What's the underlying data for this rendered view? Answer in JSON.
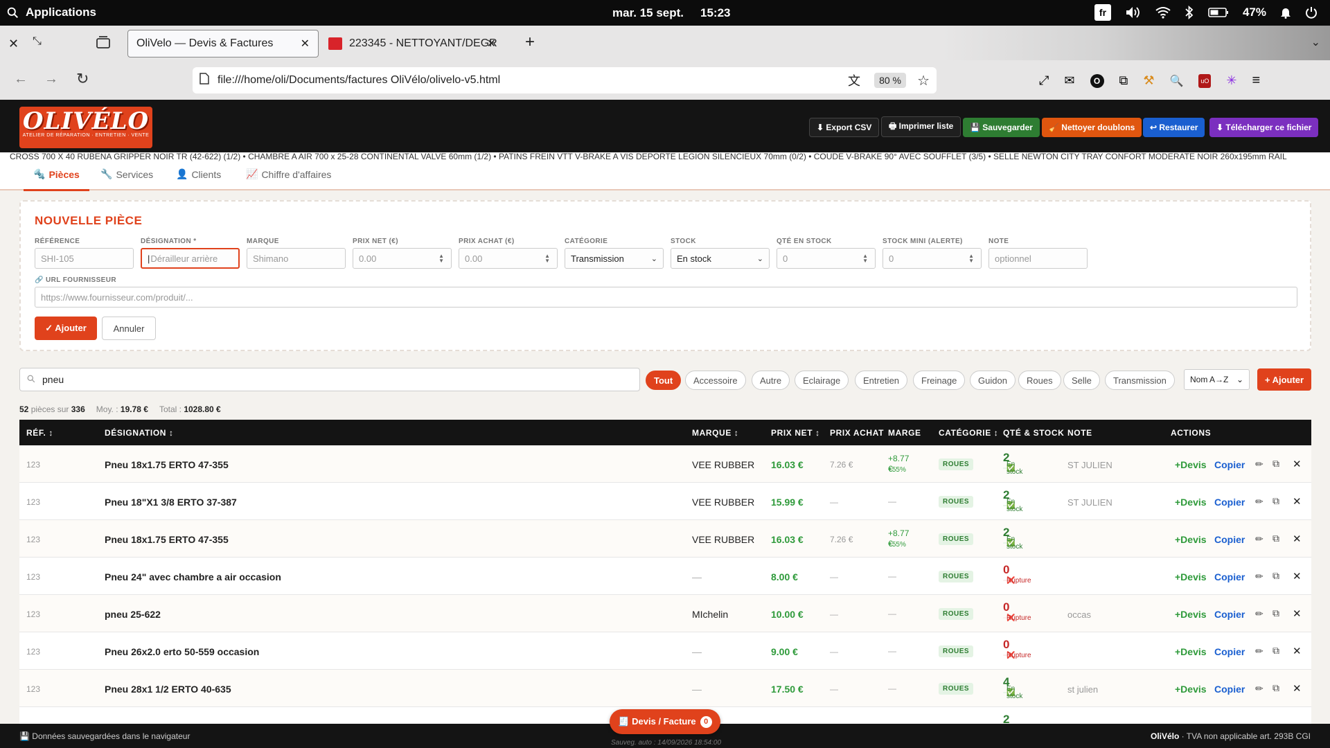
{
  "os": {
    "apps_label": "Applications",
    "date": "mar. 15 sept.",
    "time": "15:23",
    "lang": "fr",
    "battery": "47%"
  },
  "browser": {
    "tabs": [
      {
        "title": "OliVelo — Devis & Factures"
      },
      {
        "title": "223345 - NETTOYANT/DEGR"
      }
    ],
    "url": "file:///home/oli/Documents/factures OliVélo/olivelo-v5.html",
    "zoom": "80 %"
  },
  "app": {
    "logo": {
      "title": "OLIVÉLO",
      "subtitle": "ATELIER DE RÉPARATION · ENTRETIEN · VENTE"
    },
    "header_buttons": [
      {
        "label": "⬇ Export CSV",
        "color": "#1f1f1f"
      },
      {
        "label": "🖶 Imprimer liste",
        "color": "#1f1f1f"
      },
      {
        "label": "💾 Sauvegarder",
        "color": "#2e7d32"
      },
      {
        "label": "🧹 Nettoyer doublons",
        "color": "#e0560f"
      },
      {
        "label": "↩ Restaurer",
        "color": "#1a5fd0"
      },
      {
        "label": "⬇ Télécharger ce fichier",
        "color": "#7b2fbf"
      }
    ],
    "ticker": "CROSS 700 X 40 RUBENA GRIPPER NOIR TR (42-622) (1/2) • CHAMBRE A AIR 700 x 25-28 CONTINENTAL VALVE 60mm (1/2) • PATINS FREIN VTT V-BRAKE A VIS DEPORTE LEGION SILENCIEUX 70mm (0/2) • COUDE V-BRAKE 90° AVEC SOUFFLET (3/5) • SELLE NEWTON CITY TRAY CONFORT MODERATE NOIR 260x195mm RAIL",
    "tabs": [
      {
        "icon": "🔩",
        "label": "Pièces"
      },
      {
        "icon": "🔧",
        "label": "Services"
      },
      {
        "icon": "👤",
        "label": "Clients"
      },
      {
        "icon": "📈",
        "label": "Chiffre d'affaires"
      }
    ]
  },
  "form": {
    "title": "NOUVELLE PIÈCE",
    "fields": [
      {
        "label": "RÉFÉRENCE",
        "placeholder": "SHI-105"
      },
      {
        "label": "DÉSIGNATION *",
        "placeholder": "Dérailleur arrière"
      },
      {
        "label": "MARQUE",
        "placeholder": "Shimano"
      },
      {
        "label": "PRIX NET (€)",
        "placeholder": "0.00"
      },
      {
        "label": "PRIX ACHAT (€)",
        "placeholder": "0.00"
      },
      {
        "label": "CATÉGORIE",
        "value": "Transmission"
      },
      {
        "label": "STOCK",
        "value": "En stock"
      },
      {
        "label": "QTÉ EN STOCK",
        "placeholder": "0"
      },
      {
        "label": "STOCK MINI (ALERTE)",
        "placeholder": "0"
      },
      {
        "label": "NOTE",
        "placeholder": "optionnel"
      }
    ],
    "url_label": "URL FOURNISSEUR",
    "url_placeholder": "https://www.fournisseur.com/produit/...",
    "add_label": "✓ Ajouter",
    "cancel_label": "Annuler"
  },
  "filters": {
    "search_value": "pneu",
    "chips": [
      "Tout",
      "Accessoire",
      "Autre",
      "Eclairage",
      "Entretien",
      "Freinage",
      "Guidon",
      "Roues",
      "Selle",
      "Transmission"
    ],
    "active_chip": "Tout",
    "sort": "Nom A→Z",
    "add_label": "+ Ajouter"
  },
  "stats": {
    "count": "52",
    "count_suffix": "pièces sur",
    "total_count": "336",
    "avg_label": "Moy. :",
    "avg": "19.78 €",
    "total_label": "Total :",
    "total": "1028.80 €"
  },
  "table": {
    "headers": [
      "RÉF. ↕",
      "DÉSIGNATION ↕",
      "MARQUE ↕",
      "PRIX NET ↕",
      "PRIX ACHAT",
      "MARGE",
      "CATÉGORIE ↕",
      "QTÉ & STOCK",
      "NOTE",
      "ACTIONS"
    ],
    "rows": [
      {
        "ref": "123",
        "designation": "Pneu 18x1.75 ERTO 47-355",
        "marque": "VEE RUBBER",
        "prix_net": "16.03 €",
        "prix_achat": "7.26 €",
        "marge": "+8.77 €",
        "marge_pct": "+55%",
        "categorie": "ROUES",
        "qte": "2",
        "stock": "En stock",
        "in_stock": true,
        "note": "ST JULIEN"
      },
      {
        "ref": "123",
        "designation": "Pneu 18\"X1 3/8 ERTO 37-387",
        "marque": "VEE RUBBER",
        "prix_net": "15.99 €",
        "prix_achat": "—",
        "marge": "—",
        "marge_pct": "",
        "categorie": "ROUES",
        "qte": "2",
        "stock": "En stock",
        "in_stock": true,
        "note": "ST JULIEN"
      },
      {
        "ref": "123",
        "designation": "Pneu 18x1.75 ERTO 47-355",
        "marque": "VEE RUBBER",
        "prix_net": "16.03 €",
        "prix_achat": "7.26 €",
        "marge": "+8.77 €",
        "marge_pct": "+55%",
        "categorie": "ROUES",
        "qte": "2",
        "stock": "En stock",
        "in_stock": true,
        "note": ""
      },
      {
        "ref": "123",
        "designation": "Pneu 24\" avec chambre a air occasion",
        "marque": "—",
        "prix_net": "8.00 €",
        "prix_achat": "—",
        "marge": "—",
        "marge_pct": "",
        "categorie": "ROUES",
        "qte": "0",
        "stock": "Rupture",
        "in_stock": false,
        "note": ""
      },
      {
        "ref": "123",
        "designation": "pneu 25-622",
        "marque": "MIchelin",
        "prix_net": "10.00 €",
        "prix_achat": "—",
        "marge": "—",
        "marge_pct": "",
        "categorie": "ROUES",
        "qte": "0",
        "stock": "Rupture",
        "in_stock": false,
        "note": "occas"
      },
      {
        "ref": "123",
        "designation": "Pneu 26x2.0 erto 50-559 occasion",
        "marque": "—",
        "prix_net": "9.00 €",
        "prix_achat": "—",
        "marge": "—",
        "marge_pct": "",
        "categorie": "ROUES",
        "qte": "0",
        "stock": "Rupture",
        "in_stock": false,
        "note": ""
      },
      {
        "ref": "123",
        "designation": "Pneu 28x1 1/2 ERTO 40-635",
        "marque": "—",
        "prix_net": "17.50 €",
        "prix_achat": "—",
        "marge": "—",
        "marge_pct": "",
        "categorie": "ROUES",
        "qte": "4",
        "stock": "En stock",
        "in_stock": true,
        "note": "st julien"
      },
      {
        "ref": "",
        "designation": "",
        "marque": "",
        "prix_net": "",
        "prix_achat": "",
        "marge": "",
        "marge_pct": "",
        "categorie": "",
        "qte": "2",
        "stock": "",
        "in_stock": true,
        "note": ""
      }
    ],
    "action_devis": "+Devis",
    "action_copy": "Copier"
  },
  "footer": {
    "left": "💾 Données sauvegardées dans le navigateur",
    "center": "Sauveg. auto : 14/09/2026 18:54:00",
    "brand": "OliVélo",
    "right": " · TVA non applicable art. 293B CGI",
    "devis_label": "🧾 Devis / Facture",
    "devis_count": "0"
  }
}
